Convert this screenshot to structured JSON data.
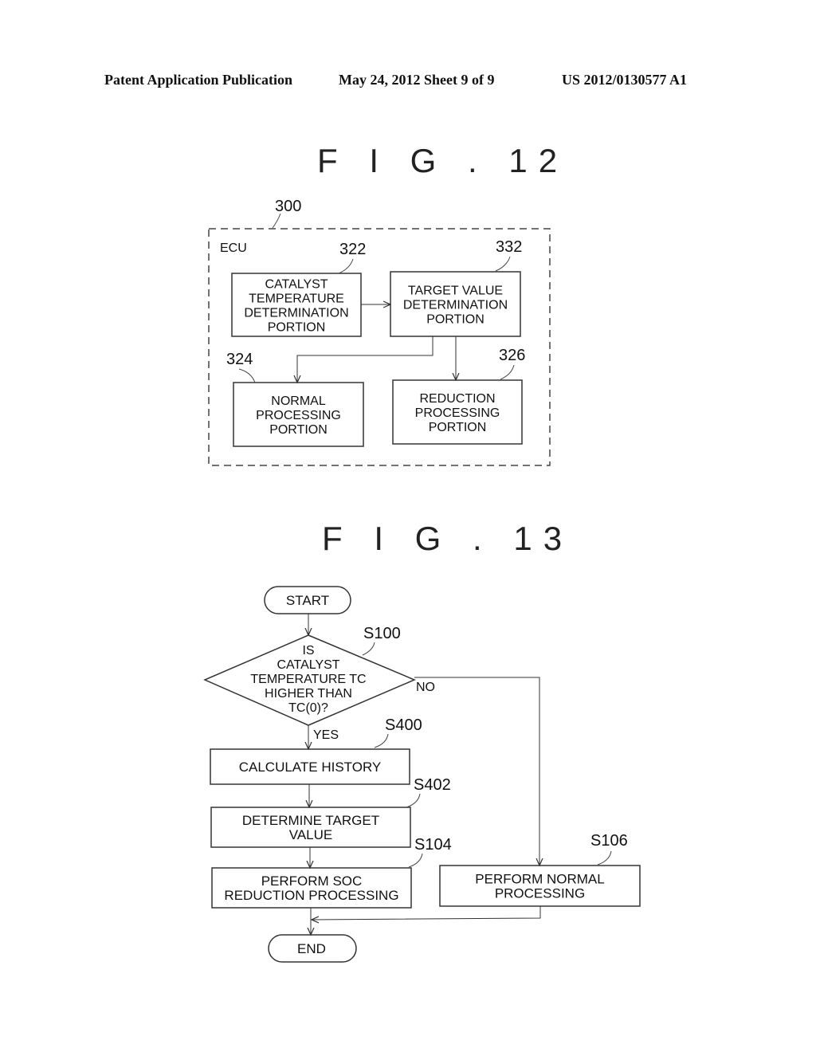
{
  "header": {
    "publication": "Patent Application Publication",
    "date_sheet": "May 24, 2012   Sheet 9 of 9",
    "number": "US 2012/0130577 A1"
  },
  "fig12": {
    "title": "F I G . 12",
    "container_ref": "300",
    "container_label": "ECU",
    "blocks": [
      {
        "ref": "322",
        "lines": [
          "CATALYST",
          "TEMPERATURE",
          "DETERMINATION",
          "PORTION"
        ]
      },
      {
        "ref": "332",
        "lines": [
          "TARGET VALUE",
          "DETERMINATION",
          "PORTION"
        ]
      },
      {
        "ref": "324",
        "lines": [
          "NORMAL",
          "PROCESSING",
          "PORTION"
        ]
      },
      {
        "ref": "326",
        "lines": [
          "REDUCTION",
          "PROCESSING",
          "PORTION"
        ]
      }
    ]
  },
  "fig13": {
    "title": "F I G . 13",
    "start": "START",
    "end": "END",
    "decision": {
      "ref": "S100",
      "lines": [
        "IS",
        "CATALYST",
        "TEMPERATURE TC",
        "HIGHER THAN",
        "TC(0)?"
      ],
      "yes": "YES",
      "no": "NO"
    },
    "steps": [
      {
        "ref": "S400",
        "lines": [
          "CALCULATE HISTORY"
        ]
      },
      {
        "ref": "S402",
        "lines": [
          "DETERMINE TARGET",
          "VALUE"
        ]
      },
      {
        "ref": "S104",
        "lines": [
          "PERFORM SOC",
          "REDUCTION PROCESSING"
        ]
      },
      {
        "ref": "S106",
        "lines": [
          "PERFORM NORMAL",
          "PROCESSING"
        ]
      }
    ]
  }
}
